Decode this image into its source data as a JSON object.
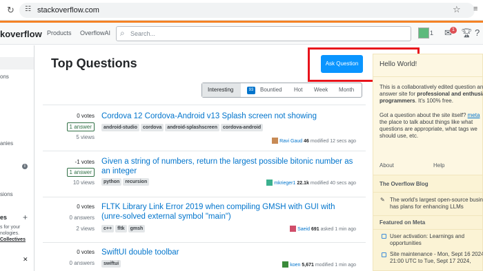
{
  "browser": {
    "url": "stackoverflow.com"
  },
  "header": {
    "logo": "koverflow",
    "nav": [
      "Products",
      "OverflowAI"
    ],
    "search_placeholder": "Search...",
    "reputation": "1",
    "inbox_badge": "1"
  },
  "leftnav": {
    "items": [
      "ons",
      "anies",
      "sions",
      "es",
      "s for your",
      "nologies.",
      "Collectives"
    ],
    "plus": "+",
    "close": "✕"
  },
  "main": {
    "title": "Top Questions",
    "ask_button": "Ask Question",
    "filters": {
      "interesting": "Interesting",
      "bountied_count": "93",
      "bountied": "Bountied",
      "hot": "Hot",
      "week": "Week",
      "month": "Month"
    },
    "questions": [
      {
        "votes": "0 votes",
        "answers": "1 answer",
        "answers_box": true,
        "views": "5 views",
        "title": "Cordova 12 Cordova-Android v13 Splash screen not showing",
        "tags": [
          "android-studio",
          "cordova",
          "android-splashscreen",
          "cordova-android"
        ],
        "user": "Ravi Gaud",
        "rep": "46",
        "time": "modified 12 secs ago",
        "avatar_color": "#c78a55"
      },
      {
        "votes": "-1 votes",
        "answers": "1 answer",
        "answers_box": true,
        "views": "10 views",
        "title": "Given a string of numbers, return the largest possible bitonic number as an integer",
        "tags": [
          "python",
          "recursion"
        ],
        "user": "mkrieger1",
        "rep": "22.1k",
        "time": "modified 40 secs ago",
        "avatar_color": "#3bb08f"
      },
      {
        "votes": "0 votes",
        "answers": "0 answers",
        "answers_box": false,
        "views": "2 views",
        "title": "FLTK Library Link Error 2019 when compiling GMSH with GUI with (unre-solved external symbol \"main\")",
        "tags": [
          "c++",
          "fltk",
          "gmsh"
        ],
        "user": "Saeid",
        "rep": "691",
        "time": "asked 1 min ago",
        "avatar_color": "#d04e6a"
      },
      {
        "votes": "0 votes",
        "answers": "0 answers",
        "answers_box": false,
        "views": "",
        "title": "SwiftUI double toolbar",
        "tags": [
          "swiftui"
        ],
        "user": "koen",
        "rep": "5,671",
        "time": "modified 1 min ago",
        "avatar_color": "#3a8a3a"
      }
    ]
  },
  "sidebar": {
    "hello_title": "Hello World!",
    "intro_line1": "This is a collaboratively edited question an",
    "intro_line2_pre": "answer site for ",
    "intro_line2_bold": "professional and enthusia",
    "intro_line3_bold": "programmers",
    "intro_line3_post": ". It's 100% free.",
    "meta_line1_pre": "Got a question about the site itself? ",
    "meta_link": "meta",
    "meta_line2": "the place to talk about things like what",
    "meta_line3": "questions are appropriate, what tags we",
    "meta_line4": "should use, etc.",
    "links": [
      "About",
      "Help"
    ],
    "blog_header": "The Overflow Blog",
    "blog_item_line1": "The world's largest open-source busin",
    "blog_item_line2": "has plans for enhancing LLMs",
    "meta_header": "Featured on Meta",
    "meta_items": [
      [
        "User activation: Learnings and",
        "opportunities"
      ],
      [
        "Site maintenance - Mon, Sept 16 2024",
        "21:00 UTC to Tue, Sept 17 2024,"
      ]
    ]
  }
}
